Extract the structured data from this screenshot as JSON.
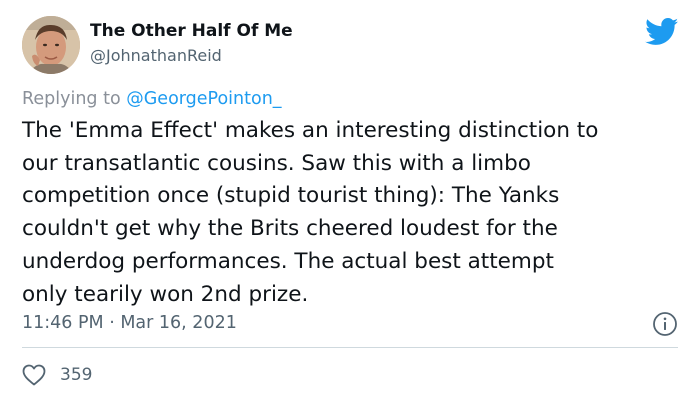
{
  "author": {
    "display_name": "The Other Half Of Me",
    "handle": "@JohnathanReid"
  },
  "reply": {
    "prefix": "Replying to",
    "mention": "@GeorgePointon_"
  },
  "tweet": {
    "lines": [
      "The 'Emma Effect' makes an interesting distinction to",
      "our transatlantic cousins. Saw this with a limbo",
      "competition once (stupid tourist thing): The Yanks",
      "couldn't get why the Brits cheered loudest for the",
      "underdog performances. The actual best attempt",
      "only tearily won 2nd prize."
    ],
    "timestamp": "11:46 PM · Mar 16, 2021"
  },
  "engagement": {
    "like_count": "359"
  },
  "icons": {
    "logo": "twitter-bird-icon",
    "info": "info-icon",
    "like": "heart-icon"
  },
  "colors": {
    "brand": "#1d9bf0",
    "secondary_text": "#536471",
    "primary_text": "#0f1419"
  }
}
